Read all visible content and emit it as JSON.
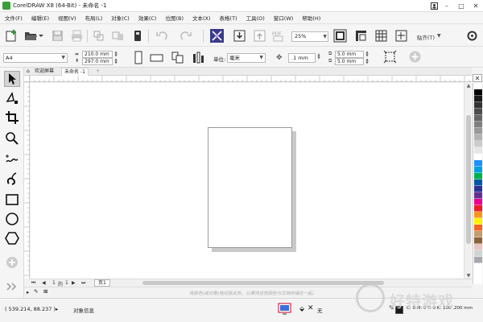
{
  "window": {
    "title": "CorelDRAW X8 (64-Bit) - 未命名 -1"
  },
  "menubar": {
    "items": [
      "文件(F)",
      "编辑(E)",
      "视图(V)",
      "布局(L)",
      "对象(C)",
      "效果(C)",
      "位图(B)",
      "文本(X)",
      "表格(T)",
      "工具(O)",
      "窗口(W)",
      "帮助(H)"
    ]
  },
  "toolbar": {
    "zoom": "25%",
    "paste_label": "贴齐(T)",
    "icons": [
      "new-document-icon",
      "open-icon",
      "save-icon",
      "print-icon",
      "import-icon",
      "export-icon",
      "publish-icon",
      "undo-icon",
      "redo-icon",
      "search-content-icon",
      "import-down-icon",
      "export-up-icon",
      "pdf-icon",
      "full-screen-icon",
      "rulers-icon",
      "grid-icon",
      "snap-icon",
      "options-icon"
    ]
  },
  "propbar": {
    "page_size": "A4",
    "width": "210.0 mm",
    "height": "297.0 mm",
    "units_label": "单位:",
    "units_value": "毫米",
    "nudge": ".1 mm",
    "dup_x": "5.0 mm",
    "dup_y": "5.0 mm"
  },
  "tabs": {
    "welcome": "欢迎屏幕",
    "document": "未命名 -1"
  },
  "pagenav": {
    "current": "1",
    "of_label": "的",
    "total": "1",
    "page_tab": "页1"
  },
  "colorrow": {
    "hint": "将颜色(或对象)拖动至此处，以便将这些颜色与文档存储在一起。"
  },
  "palette": {
    "colors": [
      "#ffffff",
      "#000000",
      "#1a1a1a",
      "#333333",
      "#4d4d4d",
      "#666666",
      "#808080",
      "#999999",
      "#b3b3b3",
      "#cccccc",
      "#e6e6e6",
      "#ffffff",
      "#1e90ff",
      "#00a0e0",
      "#00b050",
      "#0057a8",
      "#2e3192",
      "#662d91",
      "#ec008c",
      "#ed1c24",
      "#f7941d",
      "#fff200",
      "#f26522",
      "#c69c6d",
      "#8c6239",
      "#e8c5c0",
      "#d1d3d4",
      "#a7a9ac"
    ]
  },
  "status": {
    "coords": "( 539.214, 88.237 )",
    "object_info": "对象信息",
    "outline_label": "无",
    "color_info": "C: 0 M: 0 Y: 0 K: 100  .200 mm"
  },
  "watermark": {
    "text": "好特游戏"
  },
  "colors": {
    "accent": "#3b3b8c",
    "page_border": "#9a9a9a"
  }
}
